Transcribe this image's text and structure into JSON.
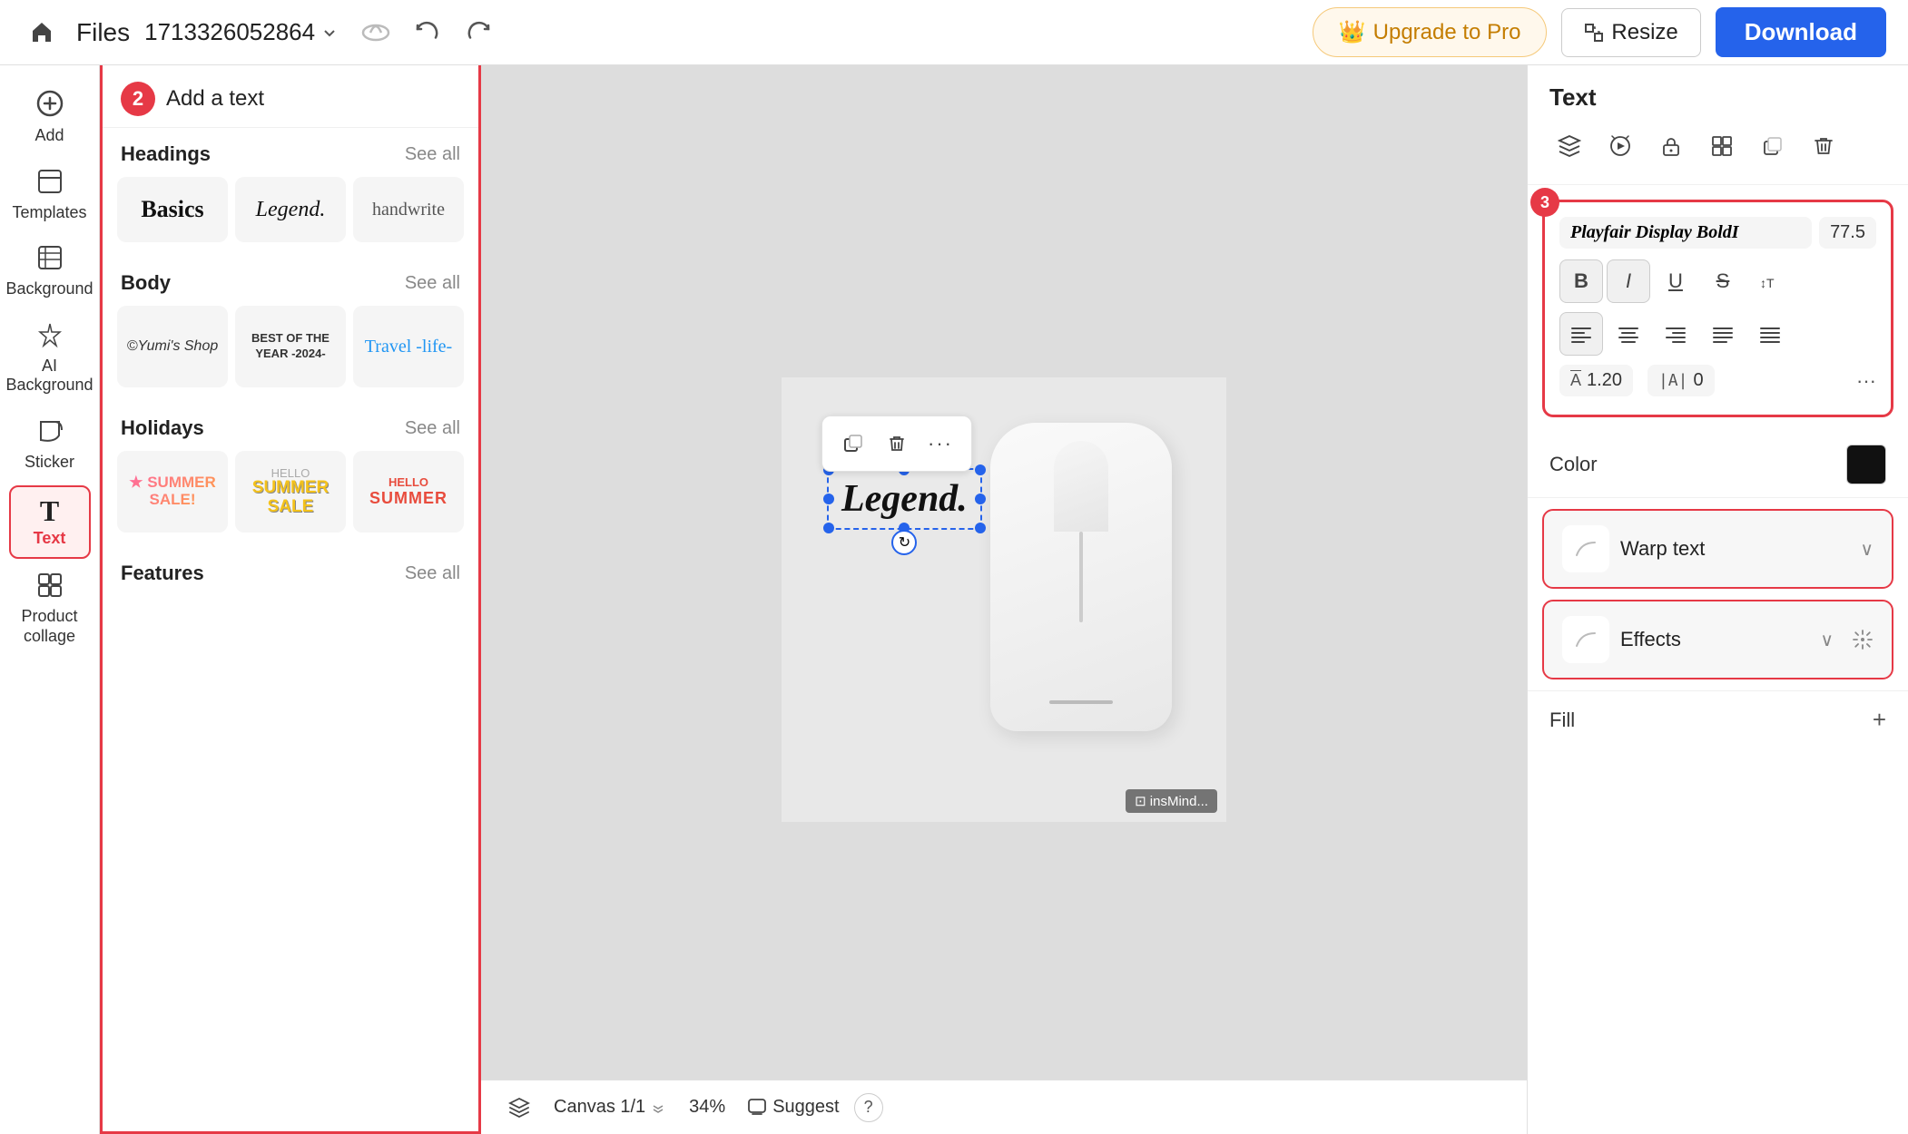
{
  "topbar": {
    "home_icon": "🏠",
    "files_label": "Files",
    "filename": "1713326052864",
    "cloud_icon": "☁",
    "undo_icon": "↩",
    "redo_icon": "↪",
    "upgrade_label": "Upgrade to Pro",
    "resize_label": "Resize",
    "download_label": "Download"
  },
  "sidebar": {
    "items": [
      {
        "id": "add",
        "icon": "⊕",
        "label": "Add"
      },
      {
        "id": "templates",
        "icon": "⬜",
        "label": "Templates"
      },
      {
        "id": "background",
        "icon": "▤",
        "label": "Background"
      },
      {
        "id": "ai-background",
        "icon": "✦",
        "label": "AI Background"
      },
      {
        "id": "sticker",
        "icon": "✂",
        "label": "Sticker"
      },
      {
        "id": "text",
        "icon": "T",
        "label": "Text",
        "active": true
      },
      {
        "id": "product-collage",
        "icon": "⊞",
        "label": "Product collage"
      }
    ]
  },
  "text_panel": {
    "step": "2",
    "title": "Add a text",
    "sections": [
      {
        "id": "headings",
        "title": "Headings",
        "see_all": "See all",
        "samples": [
          {
            "id": "basics",
            "text": "Basics"
          },
          {
            "id": "legend",
            "text": "Legend."
          },
          {
            "id": "handwrite",
            "text": "handwrite"
          }
        ]
      },
      {
        "id": "body",
        "title": "Body",
        "see_all": "See all",
        "samples": [
          {
            "id": "yumis-shop",
            "text": "©Yumi's Shop"
          },
          {
            "id": "best-of-year",
            "text": "BEST OF THE YEAR -2024-"
          },
          {
            "id": "travel-life",
            "text": "Travel -life-"
          }
        ]
      },
      {
        "id": "holidays",
        "title": "Holidays",
        "see_all": "See all",
        "samples": [
          {
            "id": "summer-sale",
            "text": "SUMMER SALE!"
          },
          {
            "id": "hello-summer-sale",
            "text": "HELLO SUMMER SALE"
          },
          {
            "id": "hello-summer",
            "text": "HELLO SUMMER"
          }
        ]
      },
      {
        "id": "features",
        "title": "Features",
        "see_all": "See all"
      }
    ]
  },
  "canvas": {
    "text_element": "Legend.",
    "toolbar_buttons": [
      "⧉",
      "🗑",
      "···"
    ],
    "canvas_info": "Canvas 1/1",
    "zoom": "34%",
    "suggest": "Suggest",
    "watermark": "⊡ insMind..."
  },
  "right_panel": {
    "title": "Text",
    "step": "3",
    "font_name": "Playfair Display BoldI",
    "font_size": "77.5",
    "format_buttons": [
      "B",
      "I",
      "U",
      "S",
      "↕T"
    ],
    "align_buttons": [
      "≡←",
      "≡",
      "≡→",
      "≡⊞",
      "≡≡"
    ],
    "line_spacing_label": "A̅",
    "line_spacing_val": "1.20",
    "char_spacing_label": "|A|",
    "char_spacing_val": "0",
    "more_label": "···",
    "color_label": "Color",
    "warp_text_label": "Warp text",
    "effects_label": "Effects",
    "fill_label": "Fill"
  }
}
